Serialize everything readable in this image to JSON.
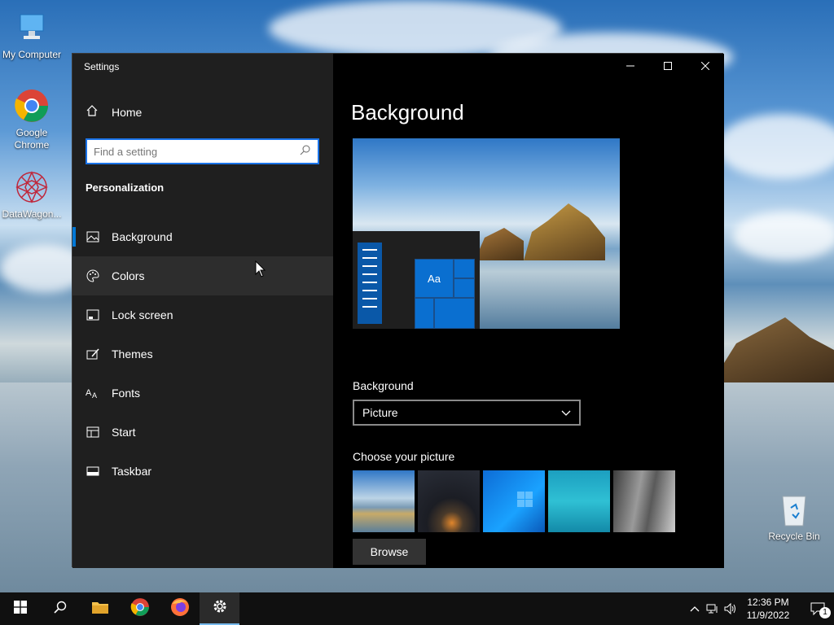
{
  "desktop": {
    "icons": [
      {
        "label": "My Computer"
      },
      {
        "label": "Google Chrome"
      },
      {
        "label": "DataWagon..."
      },
      {
        "label": "Recycle Bin"
      }
    ]
  },
  "window": {
    "title": "Settings",
    "controls": {
      "minimize": "minimize-icon",
      "maximize": "maximize-icon",
      "close": "close-icon"
    }
  },
  "sidebar": {
    "home_label": "Home",
    "search_placeholder": "Find a setting",
    "section_title": "Personalization",
    "items": [
      {
        "label": "Background",
        "icon": "picture-icon",
        "selected": true
      },
      {
        "label": "Colors",
        "icon": "palette-icon",
        "hover": true
      },
      {
        "label": "Lock screen",
        "icon": "lock-screen-icon"
      },
      {
        "label": "Themes",
        "icon": "themes-brush-icon"
      },
      {
        "label": "Fonts",
        "icon": "fonts-icon"
      },
      {
        "label": "Start",
        "icon": "start-icon"
      },
      {
        "label": "Taskbar",
        "icon": "taskbar-icon"
      }
    ]
  },
  "main": {
    "page_title": "Background",
    "preview_tile_text": "Aa",
    "background_label": "Background",
    "background_value": "Picture",
    "choose_label": "Choose your picture",
    "browse_label": "Browse"
  },
  "taskbar": {
    "clock_time": "12:36 PM",
    "clock_date": "11/9/2022",
    "notification_count": "1",
    "accent": "#76b9ed"
  },
  "colors": {
    "accent": "#0078d7",
    "sidebar_bg": "#1f1f1f",
    "main_bg": "#000000"
  }
}
